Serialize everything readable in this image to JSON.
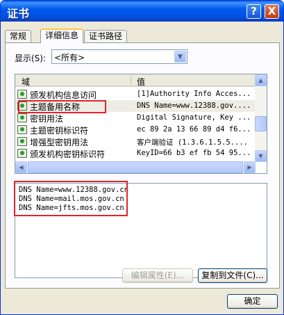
{
  "window": {
    "title": "证书",
    "help_glyph": "?",
    "close_glyph": "X"
  },
  "tabs": [
    {
      "label": "常规"
    },
    {
      "label": "详细信息"
    },
    {
      "label": "证书路径"
    }
  ],
  "show": {
    "label": "显示(S):",
    "value": "<所有>"
  },
  "list": {
    "columns": [
      "域",
      "值"
    ],
    "rows": [
      {
        "field": "颁发机构信息访问",
        "value": "[1]Authority Info Acces..."
      },
      {
        "field": "主题备用名称",
        "value": "DNS Name=www.12388.gov...."
      },
      {
        "field": "密钥用法",
        "value": "Digital Signature, Key ..."
      },
      {
        "field": "主题密钥标识符",
        "value": "ec 89 2a 13 66 89 d4 f6..."
      },
      {
        "field": "增强型密钥用法",
        "value": "客户端验证 (1.3.6.1.5.5...."
      },
      {
        "field": "颁发机构密钥标识符",
        "value": "KeyID=66 b3 ef fb 54 95..."
      }
    ]
  },
  "detail_lines": [
    "DNS Name=www.12388.gov.cn",
    "DNS Name=mail.mos.gov.cn",
    "DNS Name=jfts.mos.gov.cn"
  ],
  "buttons": {
    "edit": "编辑属性(E)...",
    "copy": "复制到文件(C)...",
    "ok": "确定"
  },
  "icons": {
    "scroll_up": "▲",
    "scroll_down": "▼",
    "scroll_left": "◀",
    "scroll_right": "▶",
    "dropdown": "▼"
  }
}
